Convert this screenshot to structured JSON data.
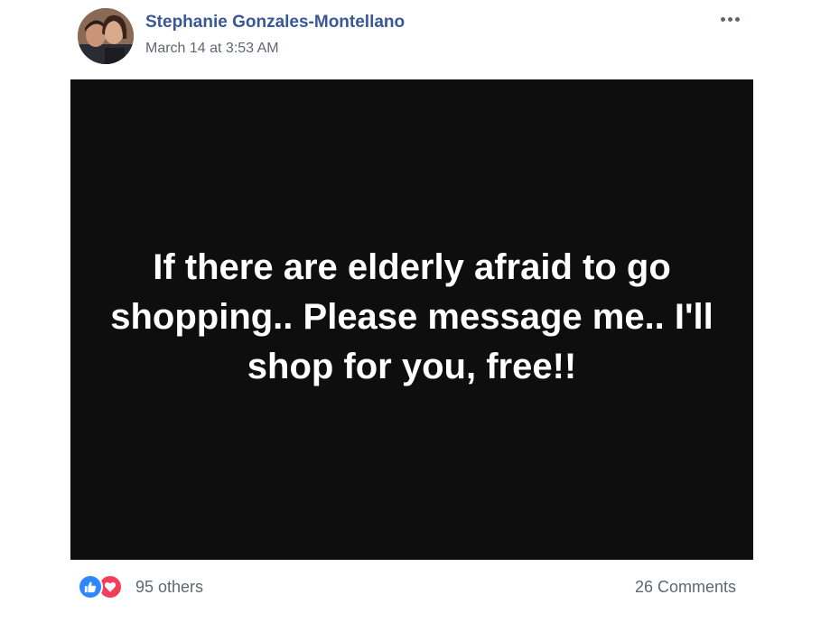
{
  "post": {
    "author": "Stephanie Gonzales-Montellano",
    "timestamp": "March 14 at 3:53 AM",
    "more_icon": "ellipsis-icon",
    "image_text": "If there are elderly afraid to go shopping.. Please message me.. I'll shop for you, free!!"
  },
  "footer": {
    "reaction_icons": [
      "like-icon",
      "love-icon"
    ],
    "reaction_count": "95 others",
    "comments": "26 Comments"
  },
  "colors": {
    "author_link": "#385898",
    "like": "#2d88ff",
    "love": "#f33e58",
    "image_background": "#0e0e0e"
  }
}
